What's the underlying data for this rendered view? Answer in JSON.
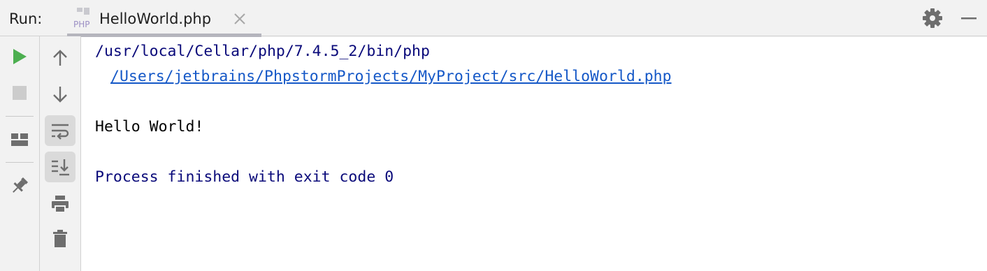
{
  "header": {
    "run_label": "Run:",
    "tab": {
      "title": "HelloWorld.php",
      "icon": "php-file-icon",
      "icon_text": "PHP"
    },
    "actions": [
      "settings-gear-icon",
      "minimize-icon"
    ]
  },
  "left_toolbar": {
    "items": [
      {
        "name": "rerun-button",
        "icon": "play-icon",
        "color": "#4caf50"
      },
      {
        "name": "stop-button",
        "icon": "stop-icon",
        "color": "#c8c8c8"
      },
      {
        "name": "layout-button",
        "icon": "layout-icon"
      },
      {
        "name": "pin-tab-button",
        "icon": "pin-icon"
      }
    ]
  },
  "console_toolbar": {
    "items": [
      {
        "name": "up-stack-button",
        "icon": "arrow-up-icon"
      },
      {
        "name": "down-stack-button",
        "icon": "arrow-down-icon"
      },
      {
        "name": "soft-wrap-button",
        "icon": "soft-wrap-icon",
        "active": true
      },
      {
        "name": "scroll-to-end-button",
        "icon": "scroll-to-end-icon",
        "active": true
      },
      {
        "name": "print-button",
        "icon": "printer-icon"
      },
      {
        "name": "clear-all-button",
        "icon": "trash-icon"
      }
    ]
  },
  "console": {
    "command": "/usr/local/Cellar/php/7.4.5_2/bin/php",
    "script_path": "/Users/jetbrains/PhpstormProjects/MyProject/src/HelloWorld.php",
    "output": "Hello World!",
    "exit_message": "Process finished with exit code 0"
  },
  "colors": {
    "command": "#0a0a7a",
    "link": "#1558c7",
    "output": "#000000",
    "exit_message": "#0a0a7a",
    "run_green": "#4caf50"
  }
}
